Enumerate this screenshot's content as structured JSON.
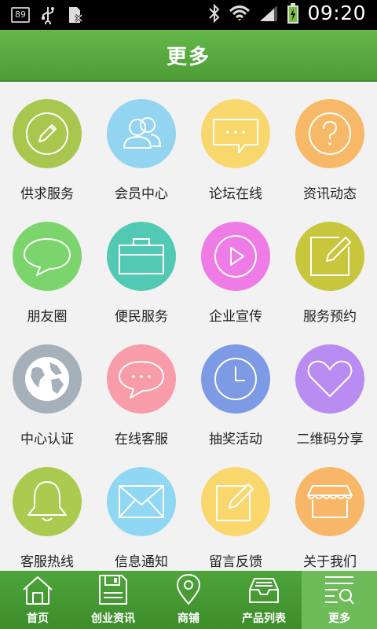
{
  "status_bar": {
    "notification_count": "89",
    "time": "09:20"
  },
  "header": {
    "title": "更多"
  },
  "grid_items": [
    {
      "label": "供求服务",
      "icon": "pencil-icon",
      "color": "#a7c64f"
    },
    {
      "label": "会员中心",
      "icon": "users-icon",
      "color": "#8fd3ef"
    },
    {
      "label": "论坛在线",
      "icon": "chat-bubble-dots-icon",
      "color": "#f7d76a"
    },
    {
      "label": "资讯动态",
      "icon": "question-icon",
      "color": "#f6b567"
    },
    {
      "label": "朋友圈",
      "icon": "speech-bubble-icon",
      "color": "#79d36b"
    },
    {
      "label": "便民服务",
      "icon": "briefcase-icon",
      "color": "#4ec8b1"
    },
    {
      "label": "企业宣传",
      "icon": "play-icon",
      "color": "#ed78e4"
    },
    {
      "label": "服务预约",
      "icon": "edit-note-icon",
      "color": "#c5c43a"
    },
    {
      "label": "中心认证",
      "icon": "globe-icon",
      "color": "#a3aeb9"
    },
    {
      "label": "在线客服",
      "icon": "chat-bubble-dots-icon",
      "color": "#f69aa6"
    },
    {
      "label": "抽奖活动",
      "icon": "clock-icon",
      "color": "#7a98e3"
    },
    {
      "label": "二维码分享",
      "icon": "heart-icon",
      "color": "#b68af0"
    },
    {
      "label": "客服热线",
      "icon": "bell-icon",
      "color": "#a8c94e"
    },
    {
      "label": "信息通知",
      "icon": "mail-icon",
      "color": "#8ed6f2"
    },
    {
      "label": "留言反馈",
      "icon": "compose-icon",
      "color": "#f8d66b"
    },
    {
      "label": "关于我们",
      "icon": "shop-icon",
      "color": "#f6b466"
    }
  ],
  "bottom_nav": [
    {
      "label": "首页",
      "icon": "home-icon"
    },
    {
      "label": "创业资讯",
      "icon": "save-icon"
    },
    {
      "label": "商铺",
      "icon": "location-pin-icon"
    },
    {
      "label": "产品列表",
      "icon": "inbox-icon"
    },
    {
      "label": "更多",
      "icon": "menu-search-icon",
      "active": true
    }
  ],
  "colors": {
    "header": "#55a83f",
    "nav": "#459733",
    "nav_active": "#6dbb59"
  }
}
